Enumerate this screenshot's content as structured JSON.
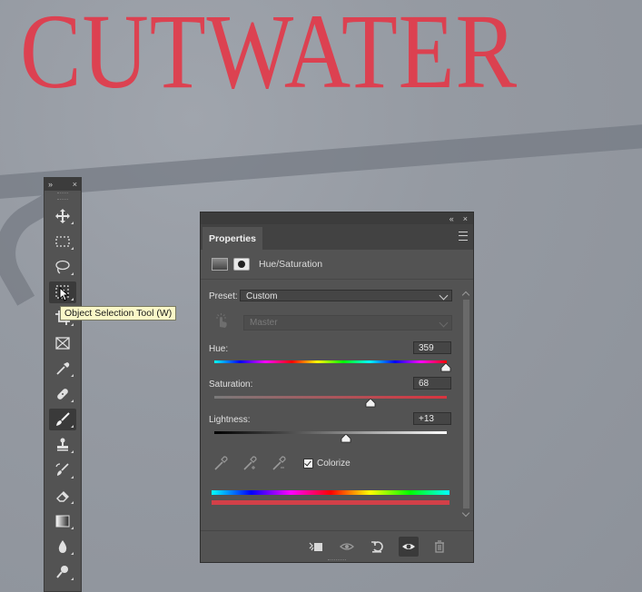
{
  "canvas": {
    "title_text": "CUTWATER"
  },
  "toolbar": {
    "collapse_glyph": "»",
    "close_glyph": "×",
    "tools": [
      {
        "name": "move-tool",
        "icon": "move-icon"
      },
      {
        "name": "marquee-tool",
        "icon": "rect-marquee-icon"
      },
      {
        "name": "lasso-tool",
        "icon": "lasso-icon"
      },
      {
        "name": "object-selection-tool",
        "icon": "object-selection-icon",
        "active": false
      },
      {
        "name": "crop-tool",
        "icon": "crop-icon"
      },
      {
        "name": "frame-tool",
        "icon": "frame-icon"
      },
      {
        "name": "eyedropper-tool",
        "icon": "eyedropper-icon"
      },
      {
        "name": "healing-brush-tool",
        "icon": "bandage-icon"
      },
      {
        "name": "brush-tool",
        "icon": "brush-icon",
        "active": true
      },
      {
        "name": "clone-stamp-tool",
        "icon": "stamp-icon"
      },
      {
        "name": "history-brush-tool",
        "icon": "history-brush-icon"
      },
      {
        "name": "eraser-tool",
        "icon": "eraser-icon"
      },
      {
        "name": "gradient-tool",
        "icon": "gradient-icon"
      },
      {
        "name": "blur-tool",
        "icon": "drop-icon"
      },
      {
        "name": "dodge-tool",
        "icon": "dodge-icon"
      }
    ],
    "tooltip": "Object Selection Tool (W)"
  },
  "panel": {
    "collapse_glyph": "«",
    "close_glyph": "×",
    "tab_label": "Properties",
    "adjustment_title": "Hue/Saturation",
    "preset_label": "Preset:",
    "preset_value": "Custom",
    "channel_value": "Master",
    "hue": {
      "label": "Hue:",
      "value": "359",
      "fraction": 0.998
    },
    "saturation": {
      "label": "Saturation:",
      "value": "68",
      "fraction": 0.673
    },
    "lightness": {
      "label": "Lightness:",
      "value": "+13",
      "fraction": 0.565
    },
    "colorize_label": "Colorize",
    "colorize_checked": true,
    "colors": {
      "panel_bg": "#535353",
      "tooltip_bg": "#fbf8c8",
      "saturation_end": "#d9343f",
      "result_bar": "#d24048"
    }
  }
}
